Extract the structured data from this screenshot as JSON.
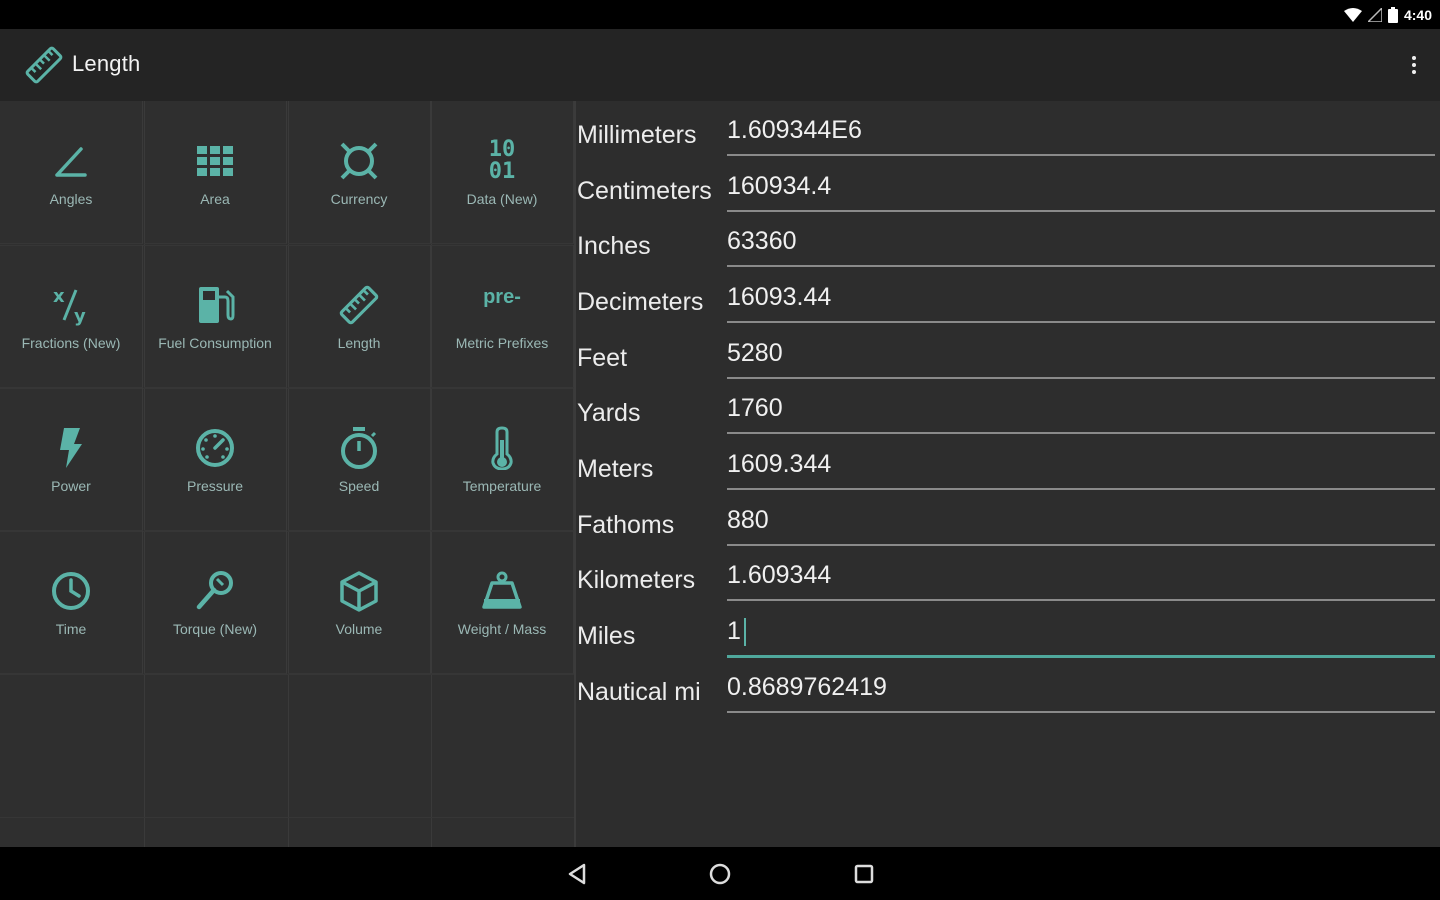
{
  "status": {
    "time": "4:40"
  },
  "app_bar": {
    "title": "Length",
    "icon": "ruler-icon"
  },
  "categories": [
    {
      "label": "Angles",
      "icon": "angle-icon"
    },
    {
      "label": "Area",
      "icon": "grid-icon"
    },
    {
      "label": "Currency",
      "icon": "currency-icon"
    },
    {
      "label": "Data (New)",
      "icon": "binary-icon"
    },
    {
      "label": "Fractions (New)",
      "icon": "fraction-icon"
    },
    {
      "label": "Fuel Consumption",
      "icon": "fuel-pump-icon"
    },
    {
      "label": "Length",
      "icon": "ruler-icon"
    },
    {
      "label": "Metric Prefixes",
      "icon": "prefix-icon",
      "icon_text": "pre-"
    },
    {
      "label": "Power",
      "icon": "lightning-icon"
    },
    {
      "label": "Pressure",
      "icon": "gauge-icon"
    },
    {
      "label": "Speed",
      "icon": "stopwatch-icon"
    },
    {
      "label": "Temperature",
      "icon": "thermometer-icon"
    },
    {
      "label": "Time",
      "icon": "clock-icon"
    },
    {
      "label": "Torque (New)",
      "icon": "wrench-icon"
    },
    {
      "label": "Volume",
      "icon": "cube-icon"
    },
    {
      "label": "Weight / Mass",
      "icon": "weight-icon"
    }
  ],
  "data_icon_text": {
    "top": "10",
    "bottom": "01"
  },
  "units": [
    {
      "name": "Millimeters",
      "value": "1.609344E6"
    },
    {
      "name": "Centimeters",
      "value": "160934.4"
    },
    {
      "name": "Inches",
      "value": "63360"
    },
    {
      "name": "Decimeters",
      "value": "16093.44"
    },
    {
      "name": "Feet",
      "value": "5280"
    },
    {
      "name": "Yards",
      "value": "1760"
    },
    {
      "name": "Meters",
      "value": "1609.344"
    },
    {
      "name": "Fathoms",
      "value": "880"
    },
    {
      "name": "Kilometers",
      "value": "1.609344"
    },
    {
      "name": "Miles",
      "value": "1",
      "active": true
    },
    {
      "name": "Nautical mi",
      "value": "0.8689762419"
    }
  ],
  "colors": {
    "accent": "#5bb3a7",
    "background": "#2d2d2d",
    "toolbar": "#242424"
  }
}
